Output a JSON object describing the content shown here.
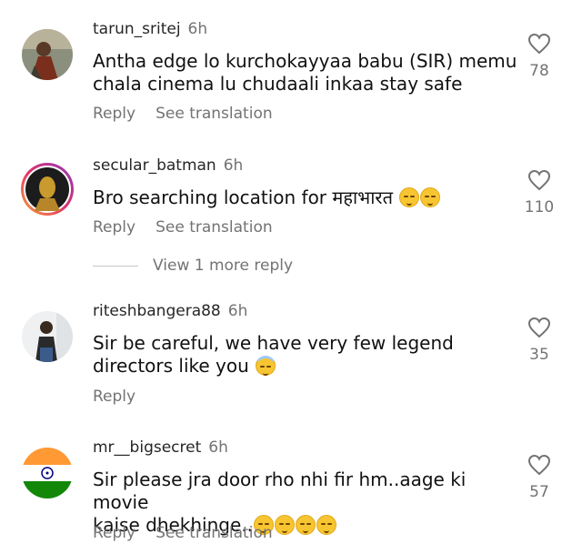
{
  "comments": [
    {
      "username": "tarun_sritej",
      "time": "6h",
      "text_line1": "Antha edge lo kurchokayyaa babu (SIR) memu",
      "text_line2": "chala cinema lu chudaali inkaa stay safe",
      "reply_label": "Reply",
      "translate_label": "See translation",
      "likes": "78"
    },
    {
      "username": "secular_batman",
      "time": "6h",
      "text": "Bro searching location for महाभारत",
      "emojis": [
        "kissing-face-smiling-eyes",
        "kissing-face-smiling-eyes"
      ],
      "reply_label": "Reply",
      "translate_label": "See translation",
      "likes": "110",
      "view_more_label": "View 1 more reply"
    },
    {
      "username": "riteshbangera88",
      "time": "6h",
      "text_line1": "Sir be careful,  we have very few legend",
      "text_line2": "directors like you",
      "emojis": [
        "smiling-face-with-halo"
      ],
      "reply_label": "Reply",
      "likes": "35"
    },
    {
      "username": "mr__bigsecret",
      "time": "6h",
      "text_line1": "Sir please jra door rho nhi fir hm..aage ki movie",
      "text_line2": "kaise dhekhinge..",
      "emojis": [
        "crying-face",
        "disappointed-face",
        "disappointed-face",
        "disappointed-face"
      ],
      "reply_label": "Reply",
      "translate_label": "See translation",
      "likes": "57"
    }
  ],
  "colors": {
    "text": "#262626",
    "secondary": "#737373",
    "emoji": "#f7c531"
  }
}
